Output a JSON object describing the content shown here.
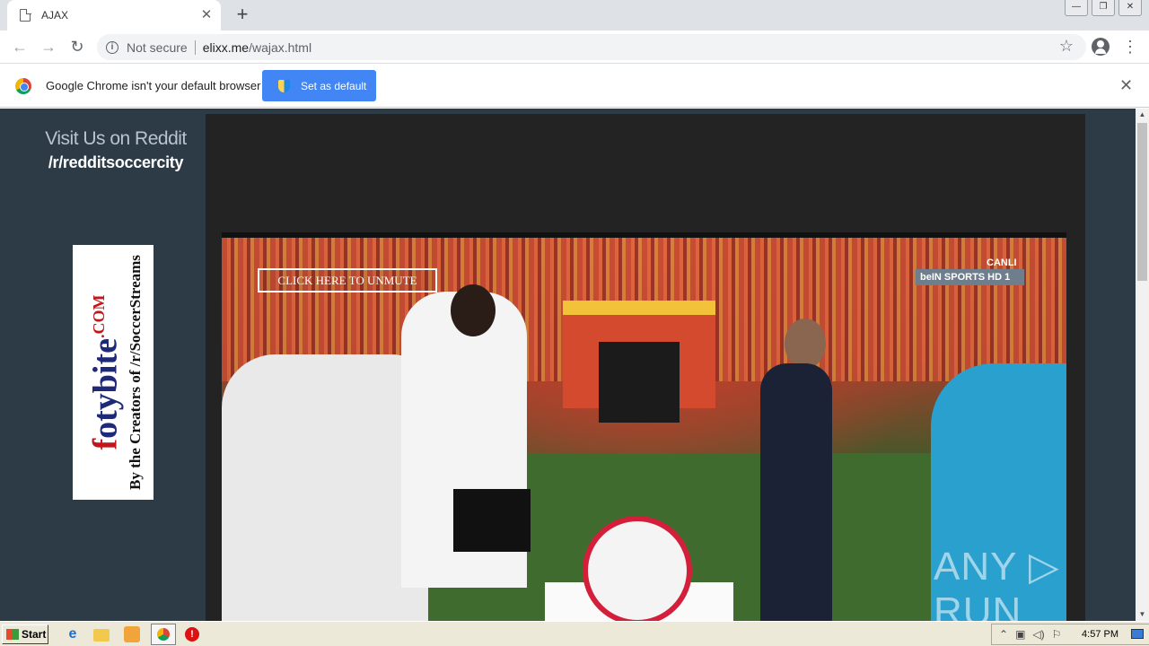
{
  "browser": {
    "tab_title": "AJAX",
    "tab_close": "✕",
    "new_tab": "+",
    "security_label": "Not secure",
    "url_host": "elixx.me",
    "url_path": "/wajax.html",
    "window_controls": [
      "—",
      "❐",
      "✕"
    ]
  },
  "infobar": {
    "message": "Google Chrome isn't your default browser",
    "button_label": "Set as default",
    "close": "✕"
  },
  "page": {
    "reddit_title": "Visit Us on Reddit",
    "reddit_sub": "/r/redditsoccercity",
    "banner": {
      "brand_f": "f",
      "brand_rest": "otybite",
      "brand_com": ".COM",
      "tagline": "By the Creators of /r/SoccerStreams"
    },
    "video": {
      "unmute_label": "CLICK HERE TO UNMUTE",
      "channel": "beIN SPORTS HD 1",
      "live_label": "CANLI"
    },
    "watermark": "ANY ▷ RUN"
  },
  "taskbar": {
    "start_label": "Start",
    "time": "4:57 PM"
  },
  "colors": {
    "page_bg": "#2d3b47",
    "accent_blue": "#4285f4",
    "brand_navy": "#1e2a78",
    "brand_red": "#c3161c"
  },
  "icons": [
    "document-icon",
    "info-icon",
    "star-icon",
    "profile-icon",
    "menu-icon",
    "chrome-logo-icon",
    "shield-icon",
    "windows-flag-icon",
    "ie-icon",
    "folder-icon",
    "media-icon",
    "chrome-icon",
    "stop-icon",
    "monitor-icon"
  ]
}
